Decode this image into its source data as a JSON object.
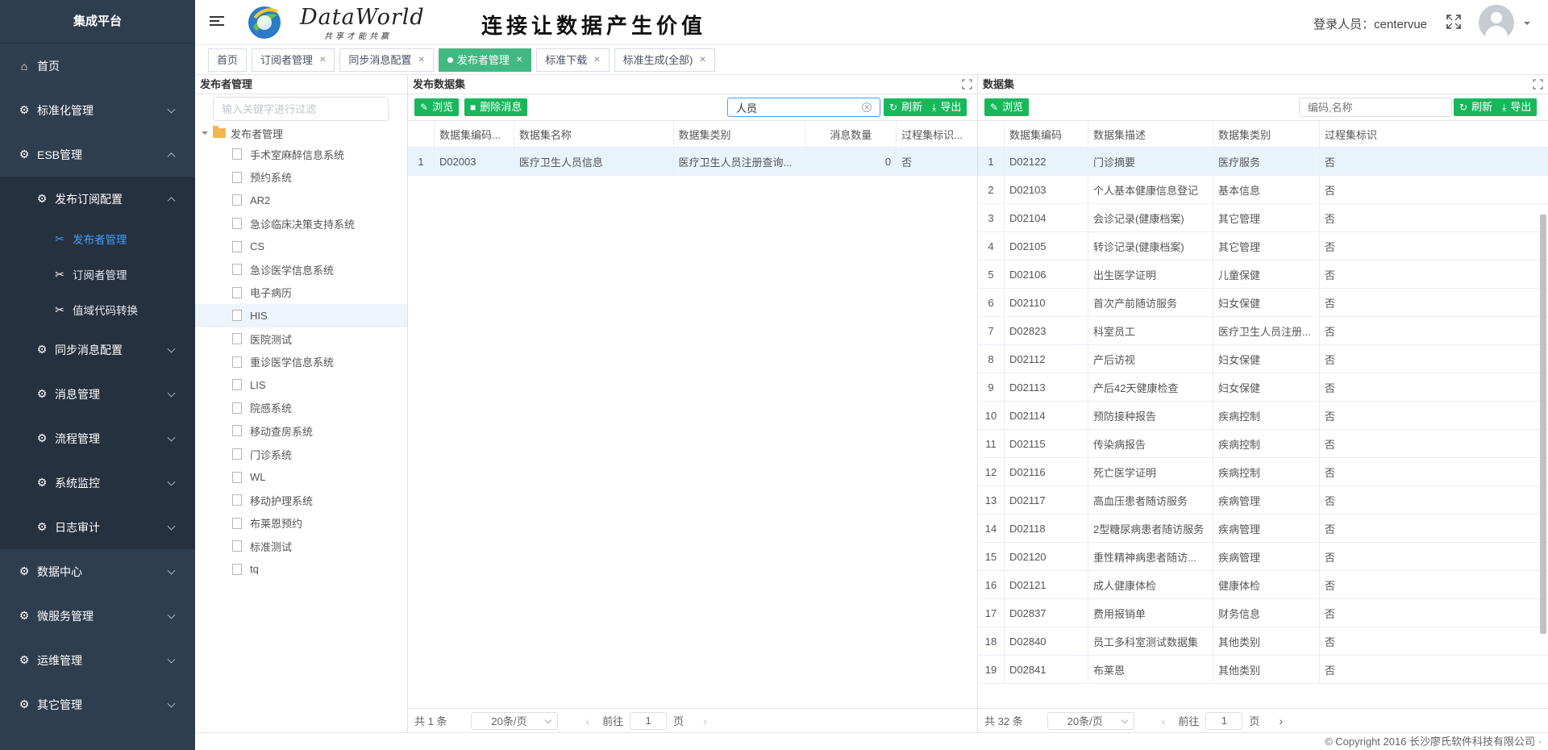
{
  "sidebar": {
    "title": "集成平台",
    "items": [
      {
        "label": "首页",
        "icon": "home-icon"
      },
      {
        "label": "标准化管理",
        "icon": "gear-icon"
      },
      {
        "label": "ESB管理",
        "icon": "gear-icon"
      },
      {
        "label": "发布订阅配置",
        "icon": "gear-icon"
      },
      {
        "label": "发布者管理",
        "icon": "tools-icon"
      },
      {
        "label": "订阅者管理",
        "icon": "tools-icon"
      },
      {
        "label": "值域代码转换",
        "icon": "tools-icon"
      },
      {
        "label": "同步消息配置",
        "icon": "gear-icon"
      },
      {
        "label": "消息管理",
        "icon": "gear-icon"
      },
      {
        "label": "流程管理",
        "icon": "gear-icon"
      },
      {
        "label": "系统监控",
        "icon": "gear-icon"
      },
      {
        "label": "日志审计",
        "icon": "gear-icon"
      },
      {
        "label": "数据中心",
        "icon": "gear-icon"
      },
      {
        "label": "微服务管理",
        "icon": "gear-icon"
      },
      {
        "label": "运维管理",
        "icon": "gear-icon"
      },
      {
        "label": "其它管理",
        "icon": "gear-icon"
      }
    ]
  },
  "header": {
    "brand": "DataWorld",
    "brand_sub": "共享才能共赢",
    "slogan": "连接让数据产生价值",
    "user": "登录人员：centervue"
  },
  "tabs": [
    {
      "label": "首页",
      "closable": false
    },
    {
      "label": "订阅者管理",
      "closable": true
    },
    {
      "label": "同步消息配置",
      "closable": true
    },
    {
      "label": "发布者管理",
      "closable": true,
      "active": true
    },
    {
      "label": "标准下载",
      "closable": true
    },
    {
      "label": "标准生成(全部)",
      "closable": true
    }
  ],
  "left_panel": {
    "title": "发布者管理",
    "filter_placeholder": "输入关键字进行过滤",
    "root": "发布者管理",
    "nodes": [
      "手术室麻醉信息系统",
      "预约系统",
      "AR2",
      "急诊临床决策支持系统",
      "CS",
      "急诊医学信息系统",
      "电子病历",
      "HIS",
      "医院测试",
      "重诊医学信息系统",
      "LIS",
      "院感系统",
      "移动查房系统",
      "门诊系统",
      "WL",
      "移动护理系统",
      "布莱恩预约",
      "标准测试",
      "tq"
    ],
    "selected": "HIS"
  },
  "mid_panel": {
    "title": "发布数据集",
    "browse": "浏览",
    "delete": "删除消息",
    "search_value": "人员",
    "refresh": "刷新",
    "export": "导出",
    "columns": [
      "数据集编码...",
      "数据集名称",
      "数据集类别",
      "消息数量",
      "过程集标识..."
    ],
    "rows": [
      {
        "idx": "1",
        "code": "D02003",
        "name": "医疗卫生人员信息",
        "category": "医疗卫生人员注册查询...",
        "count": "0",
        "flag": "否"
      }
    ],
    "total": "共 1 条",
    "page_size": "20条/页",
    "goto": "前往",
    "page": "1",
    "page_unit": "页"
  },
  "right_panel": {
    "title": "数据集",
    "browse": "浏览",
    "search_placeholder": "编码,名称",
    "refresh": "刷新",
    "export": "导出",
    "columns": [
      "数据集编码",
      "数据集描述",
      "数据集类别",
      "过程集标识"
    ],
    "rows": [
      {
        "idx": "1",
        "code": "D02122",
        "desc": "门诊摘要",
        "cat": "医疗服务",
        "flag": "否"
      },
      {
        "idx": "2",
        "code": "D02103",
        "desc": "个人基本健康信息登记",
        "cat": "基本信息",
        "flag": "否"
      },
      {
        "idx": "3",
        "code": "D02104",
        "desc": "会诊记录(健康档案)",
        "cat": "其它管理",
        "flag": "否"
      },
      {
        "idx": "4",
        "code": "D02105",
        "desc": "转诊记录(健康档案)",
        "cat": "其它管理",
        "flag": "否"
      },
      {
        "idx": "5",
        "code": "D02106",
        "desc": "出生医学证明",
        "cat": "儿童保健",
        "flag": "否"
      },
      {
        "idx": "6",
        "code": "D02110",
        "desc": "首次产前随访服务",
        "cat": "妇女保健",
        "flag": "否"
      },
      {
        "idx": "7",
        "code": "D02823",
        "desc": "科室员工",
        "cat": "医疗卫生人员注册...",
        "flag": "否"
      },
      {
        "idx": "8",
        "code": "D02112",
        "desc": "产后访视",
        "cat": "妇女保健",
        "flag": "否"
      },
      {
        "idx": "9",
        "code": "D02113",
        "desc": "产后42天健康检查",
        "cat": "妇女保健",
        "flag": "否"
      },
      {
        "idx": "10",
        "code": "D02114",
        "desc": "预防接种报告",
        "cat": "疾病控制",
        "flag": "否"
      },
      {
        "idx": "11",
        "code": "D02115",
        "desc": "传染病报告",
        "cat": "疾病控制",
        "flag": "否"
      },
      {
        "idx": "12",
        "code": "D02116",
        "desc": "死亡医学证明",
        "cat": "疾病控制",
        "flag": "否"
      },
      {
        "idx": "13",
        "code": "D02117",
        "desc": "高血压患者随访服务",
        "cat": "疾病管理",
        "flag": "否"
      },
      {
        "idx": "14",
        "code": "D02118",
        "desc": "2型糖尿病患者随访服务",
        "cat": "疾病管理",
        "flag": "否"
      },
      {
        "idx": "15",
        "code": "D02120",
        "desc": "重性精神病患者随访...",
        "cat": "疾病管理",
        "flag": "否"
      },
      {
        "idx": "16",
        "code": "D02121",
        "desc": "成人健康体检",
        "cat": "健康体检",
        "flag": "否"
      },
      {
        "idx": "17",
        "code": "D02837",
        "desc": "费用报销单",
        "cat": "财务信息",
        "flag": "否"
      },
      {
        "idx": "18",
        "code": "D02840",
        "desc": "员工多科室测试数据集",
        "cat": "其他类别",
        "flag": "否"
      },
      {
        "idx": "19",
        "code": "D02841",
        "desc": "布莱恩",
        "cat": "其他类别",
        "flag": "否"
      }
    ],
    "total": "共 32 条",
    "page_size": "20条/页",
    "goto": "前往",
    "page": "1",
    "page_unit": "页"
  },
  "copyright": "© Copyright 2016 长沙廖氏软件科技有限公司 ·",
  "colors": {
    "sidebar_bg": "#2f3e4f",
    "accent_green": "#16b85a",
    "active_tab": "#42b983",
    "link_blue": "#409eff"
  }
}
